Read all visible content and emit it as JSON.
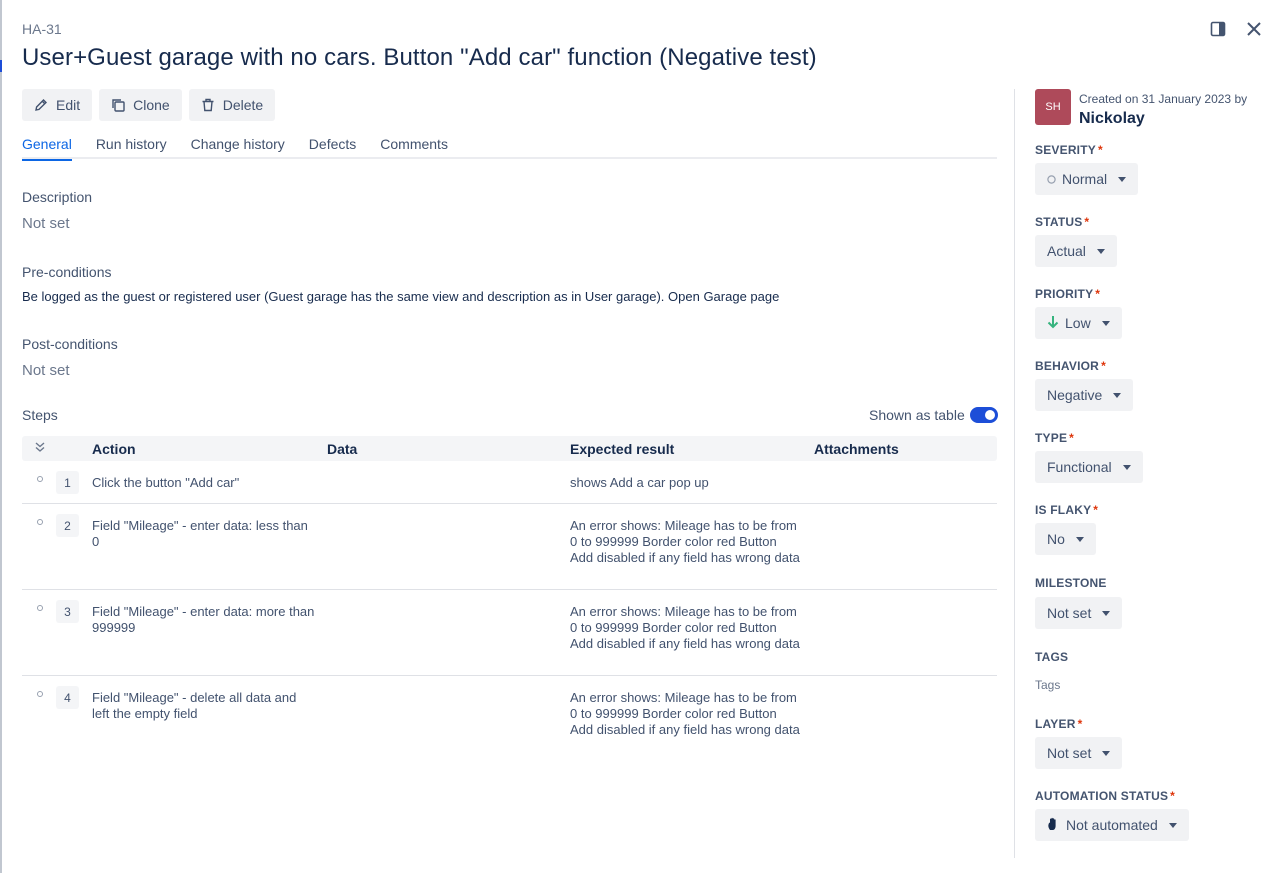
{
  "issue": {
    "key": "HA-31",
    "title": "User+Guest garage with no cars. Button \"Add car\" function (Negative test)"
  },
  "toolbar": {
    "edit_label": "Edit",
    "clone_label": "Clone",
    "delete_label": "Delete"
  },
  "tabs": [
    {
      "label": "General",
      "active": true
    },
    {
      "label": "Run history",
      "active": false
    },
    {
      "label": "Change history",
      "active": false
    },
    {
      "label": "Defects",
      "active": false
    },
    {
      "label": "Comments",
      "active": false
    }
  ],
  "description": {
    "label": "Description",
    "value": "Not set"
  },
  "preconditions": {
    "label": "Pre-conditions",
    "value": "Be logged as the guest or registered user (Guest garage has the same view and description as in User garage). Open Garage page"
  },
  "postconditions": {
    "label": "Post-conditions",
    "value": "Not set"
  },
  "steps": {
    "label": "Steps",
    "shown_as_table_label": "Shown as table",
    "shown_as_table": true,
    "columns": {
      "action": "Action",
      "data": "Data",
      "expected": "Expected result",
      "attachments": "Attachments"
    },
    "rows": [
      {
        "num": "1",
        "action": "Click the button \"Add car\"",
        "data": "",
        "expected": "shows Add a car pop up"
      },
      {
        "num": "2",
        "action": "Field \"Mileage\" - enter data: less than 0",
        "data": "",
        "expected": "An error shows: Mileage has to be from 0 to 999999 Border color red Button Add disabled if any field has wrong data"
      },
      {
        "num": "3",
        "action": "Field \"Mileage\" - enter data: more than 999999",
        "data": "",
        "expected": "An error shows: Mileage has to be from 0 to 999999 Border color red Button Add disabled if any field has wrong data"
      },
      {
        "num": "4",
        "action": "Field \"Mileage\" - delete all data and left the empty field",
        "data": "",
        "expected": "An error shows: Mileage has to be from 0 to 999999 Border color red Button Add disabled if any field has wrong data"
      }
    ]
  },
  "sidebar": {
    "avatar_initials": "SH",
    "avatar_color": "#ae4a5a",
    "created_text": "Created on 31 January 2023 by",
    "author": "Nickolay",
    "severity": {
      "label": "SEVERITY",
      "value": "Normal",
      "icon": "circle-outline-icon"
    },
    "status": {
      "label": "STATUS",
      "value": "Actual"
    },
    "priority": {
      "label": "PRIORITY",
      "value": "Low",
      "icon": "arrow-down-icon",
      "icon_color": "#36b37e"
    },
    "behavior": {
      "label": "BEHAVIOR",
      "value": "Negative"
    },
    "type": {
      "label": "TYPE",
      "value": "Functional"
    },
    "is_flaky": {
      "label": "IS FLAKY",
      "value": "No"
    },
    "milestone": {
      "label": "MILESTONE",
      "value": "Not set"
    },
    "tags": {
      "label": "TAGS",
      "value": "Tags"
    },
    "layer": {
      "label": "LAYER",
      "value": "Not set"
    },
    "automation_status": {
      "label": "AUTOMATION STATUS",
      "value": "Not automated",
      "icon": "hand-icon"
    },
    "required_mark": "*"
  }
}
